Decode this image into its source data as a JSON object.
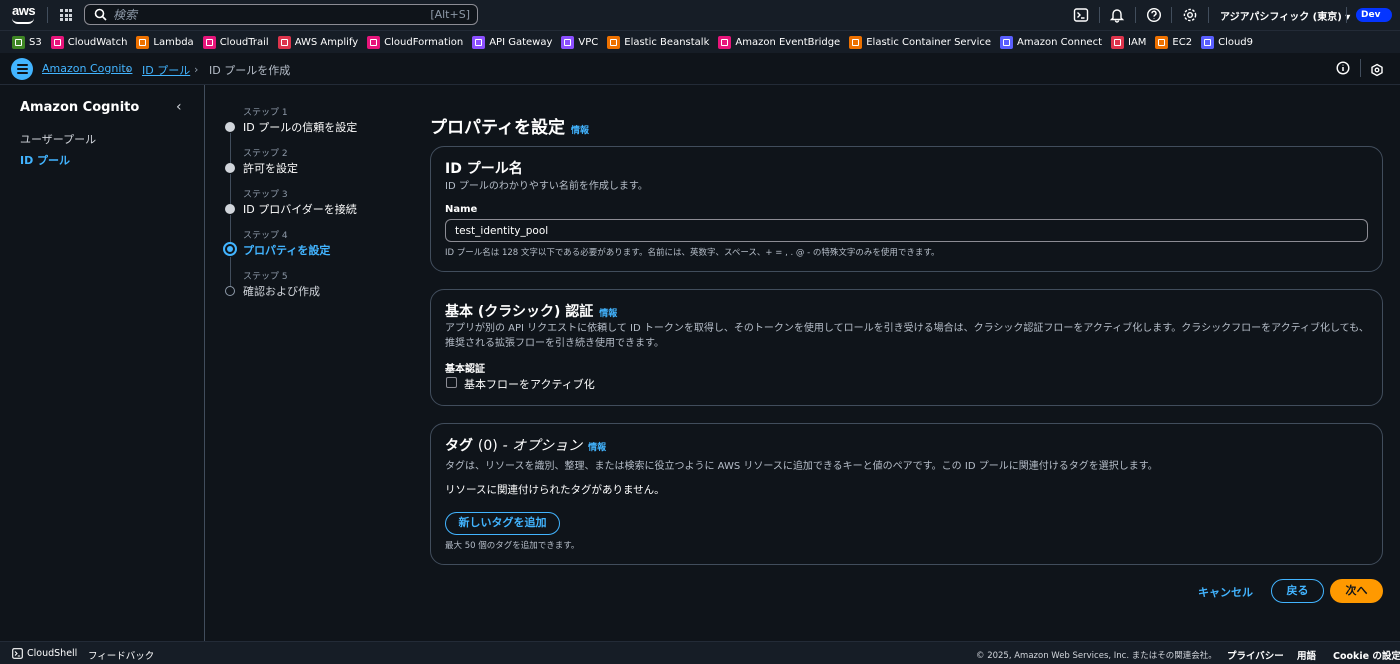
{
  "topnav": {
    "search_placeholder": "検索",
    "search_shortcut": "[Alt+S]",
    "region": "アジアパシフィック (東京) ▾",
    "account": "Dev"
  },
  "favorites": [
    {
      "label": "S3",
      "color": "#3f8624"
    },
    {
      "label": "CloudWatch",
      "color": "#e7157b"
    },
    {
      "label": "Lambda",
      "color": "#ed7100"
    },
    {
      "label": "CloudTrail",
      "color": "#e7157b"
    },
    {
      "label": "AWS Amplify",
      "color": "#dd344c"
    },
    {
      "label": "CloudFormation",
      "color": "#e7157b"
    },
    {
      "label": "API Gateway",
      "color": "#8c4fff"
    },
    {
      "label": "VPC",
      "color": "#8c4fff"
    },
    {
      "label": "Elastic Beanstalk",
      "color": "#ed7100"
    },
    {
      "label": "Amazon EventBridge",
      "color": "#e7157b"
    },
    {
      "label": "Elastic Container Service",
      "color": "#ed7100"
    },
    {
      "label": "Amazon Connect",
      "color": "#5a5fff"
    },
    {
      "label": "IAM",
      "color": "#dd344c"
    },
    {
      "label": "EC2",
      "color": "#ed7100"
    },
    {
      "label": "Cloud9",
      "color": "#5a5fff"
    }
  ],
  "breadcrumb": {
    "item1": "Amazon Cognito",
    "item2": "ID プール",
    "item3": "ID プールを作成"
  },
  "sidebar": {
    "title": "Amazon Cognito",
    "items": [
      {
        "label": "ユーザープール"
      },
      {
        "label": "ID プール"
      }
    ]
  },
  "steps": [
    {
      "label": "ステップ 1",
      "name": "ID プールの信頼を設定"
    },
    {
      "label": "ステップ 2",
      "name": "許可を設定"
    },
    {
      "label": "ステップ 3",
      "name": "ID プロバイダーを接続"
    },
    {
      "label": "ステップ 4",
      "name": "プロパティを設定"
    },
    {
      "label": "ステップ 5",
      "name": "確認および作成"
    }
  ],
  "page": {
    "title": "プロパティを設定",
    "info": "情報"
  },
  "pool_name_card": {
    "title": "ID プール名",
    "desc": "ID プールのわかりやすい名前を作成します。",
    "field_label": "Name",
    "value": "test_identity_pool",
    "hint": "ID プール名は 128 文字以下である必要があります。名前には、英数字、スペース、+ = , . @ - の特殊文字のみを使用できます。"
  },
  "basic_auth_card": {
    "title": "基本 (クラシック) 認証",
    "info": "情報",
    "desc": "アプリが別の API リクエストに依頼して ID トークンを取得し、そのトークンを使用してロールを引き受ける場合は、クラシック認証フローをアクティブ化します。クラシックフローをアクティブ化しても、推奨される拡張フローを引き続き使用できます。",
    "field_label": "基本認証",
    "checkbox_label": "基本フローをアクティブ化"
  },
  "tags_card": {
    "title": "タグ",
    "count": "(0)",
    "optional": "- オプション",
    "info": "情報",
    "desc": "タグは、リソースを識別、整理、または検索に役立つように AWS リソースに追加できるキーと値のペアです。この ID プールに関連付けるタグを選択します。",
    "empty": "リソースに関連付けられたタグがありません。",
    "add_button": "新しいタグを追加",
    "limit": "最大 50 個のタグを追加できます。"
  },
  "actions": {
    "cancel": "キャンセル",
    "back": "戻る",
    "next": "次へ"
  },
  "footer": {
    "cloudshell": "CloudShell",
    "feedback": "フィードバック",
    "copyright": "© 2025, Amazon Web Services, Inc. またはその関連会社。",
    "privacy": "プライバシー",
    "terms": "用語",
    "cookie": "Cookie の設定"
  }
}
